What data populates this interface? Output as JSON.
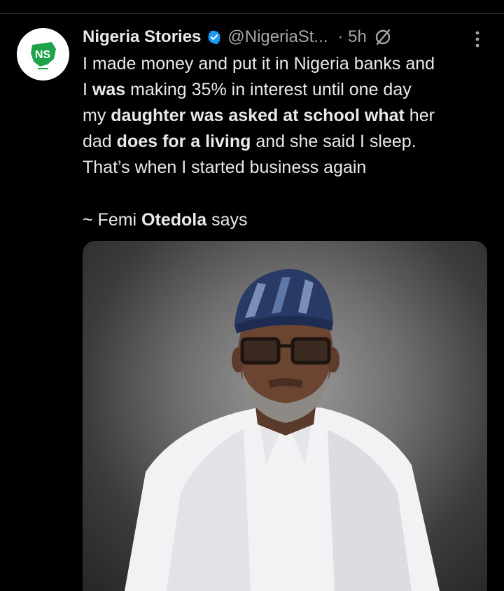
{
  "tweet": {
    "author_name": "Nigeria Stories",
    "handle": "@NigeriaSt...",
    "time": "· 5h",
    "avatar_text": "NS",
    "lines": [
      [
        {
          "t": "I made money and put it in Nigeria banks and",
          "b": false
        }
      ],
      [
        {
          "t": "I ",
          "b": false
        },
        {
          "t": "was",
          "b": true
        },
        {
          "t": " making  35% in interest until one day",
          "b": false
        }
      ],
      [
        {
          "t": "my ",
          "b": false
        },
        {
          "t": "daughter was asked at school what",
          "b": true
        },
        {
          "t": " her",
          "b": false
        }
      ],
      [
        {
          "t": "dad ",
          "b": false
        },
        {
          "t": "does for a living",
          "b": true
        },
        {
          "t": " and she said I sleep.",
          "b": false
        }
      ],
      [
        {
          "t": "That’s when I started business again",
          "b": false
        }
      ]
    ],
    "attribution": [
      {
        "t": "~ Femi ",
        "b": false
      },
      {
        "t": "Otedola",
        "b": true
      },
      {
        "t": " says",
        "b": false
      }
    ]
  },
  "icons": {
    "verified": "verified-badge-icon",
    "muted": "muted-circle-slash-icon",
    "more": "more-options-icon"
  },
  "colors": {
    "background": "#000000",
    "text": "#e7e9ea",
    "secondary": "#a3a7ab",
    "verified": "#1d9bf0",
    "logo_green": "#1fa24a"
  }
}
